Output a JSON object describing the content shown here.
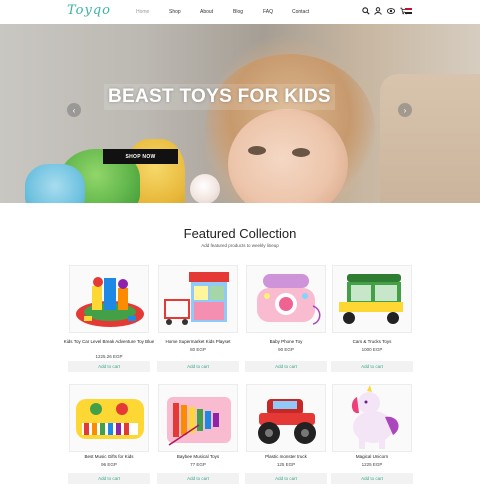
{
  "logo": "Toyqo",
  "nav": [
    "Home",
    "Shop",
    "About",
    "Blog",
    "FAQ",
    "Contact"
  ],
  "header_icons": [
    "search-icon",
    "user-icon",
    "eye-icon",
    "cart-icon",
    "flag-icon"
  ],
  "hero": {
    "title": "BEAST TOYS FOR KIDS",
    "button": "SHOP NOW"
  },
  "featured": {
    "title": "Featured Collection",
    "subtitle": "Add featured products to weekly lineup",
    "cart_label": "Add to cart",
    "products": [
      {
        "name": "Kids Toy Car Level Break Adventure Toy Blue",
        "price": "1225.26 EGP"
      },
      {
        "name": "Home Supermarket Kids Playset",
        "price": "80 EGP"
      },
      {
        "name": "Baby Phone Toy",
        "price": "90 EGP"
      },
      {
        "name": "Cars & Trucks Toys",
        "price": "1000 EGP"
      },
      {
        "name": "Best Music Gifts for Kids",
        "price": "96 EGP"
      },
      {
        "name": "Baybee Musical Toys",
        "price": "77 EGP"
      },
      {
        "name": "Plastic monster truck",
        "price": "125 EGP"
      },
      {
        "name": "Magical Unicorn",
        "price": "1225 EGP"
      }
    ]
  },
  "colors": {
    "brand": "#3bb3a4",
    "cart_text": "#3aa58c",
    "button_bg": "#111111"
  }
}
